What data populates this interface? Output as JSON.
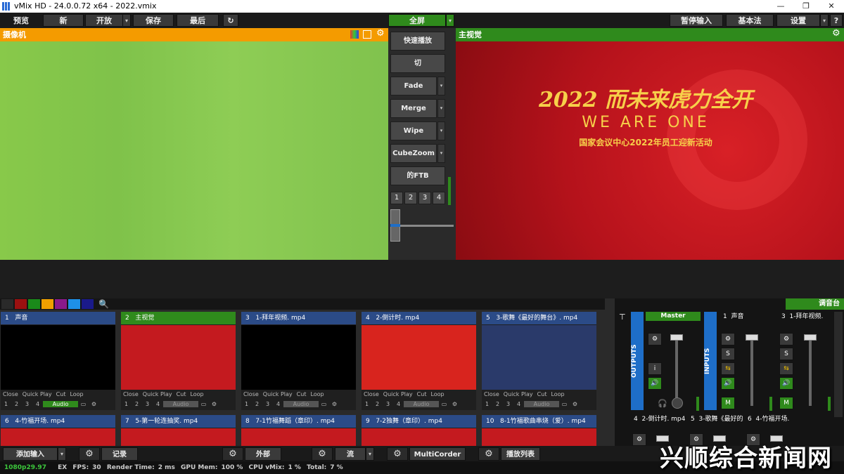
{
  "window": {
    "title": "vMix HD - 24.0.0.72 x64 - 2022.vmix",
    "minimize": "—",
    "maximize": "❐",
    "close": "✕"
  },
  "toolbar": {
    "preview_label": "预览",
    "new_label": "新",
    "open_label": "开放",
    "save_label": "保存",
    "last_label": "最后",
    "fullscreen_label": "全屏",
    "pause_input_label": "暂停输入",
    "basic_label": "基本法",
    "settings_label": "设置",
    "help_label": "?"
  },
  "preview": {
    "title": "摄像机"
  },
  "program": {
    "title": "主视觉",
    "headline": "2022 而未来虎力全开",
    "subhead": "WE ARE ONE",
    "caption": "国家会议中心2022年员工迎新活动"
  },
  "transitions": {
    "quick_play": "快速播放",
    "cut": "切",
    "fade": "Fade",
    "merge": "Merge",
    "wipe": "Wipe",
    "cubezoom": "CubeZoom",
    "ftb": "的FTB",
    "numbers": [
      "1",
      "2",
      "3",
      "4"
    ],
    "tbar_value": 0
  },
  "swatch_colors": [
    "#2a2a2a",
    "#9b1010",
    "#1a8a1a",
    "#f0a000",
    "#8a1a8a",
    "#1e90e8",
    "#1a1a8a"
  ],
  "inputs": [
    {
      "num": "1",
      "name": "声音",
      "thumb": "#000000",
      "active": false,
      "audio_on": true
    },
    {
      "num": "2",
      "name": "主视觉",
      "thumb": "#c41a1f",
      "active": true,
      "audio_on": false
    },
    {
      "num": "3",
      "name": "1-拜年视频. mp4",
      "thumb": "#000000",
      "active": false,
      "audio_on": false
    },
    {
      "num": "4",
      "name": "2-倒计时. mp4",
      "thumb": "#d8241e",
      "active": false,
      "audio_on": false
    },
    {
      "num": "5",
      "name": "3-歌舞《最好的舞台》. mp4",
      "thumb": "#2a3a6a",
      "active": false,
      "audio_on": false
    }
  ],
  "input_controls": {
    "close": "Close",
    "quick_play": "Quick Play",
    "cut": "Cut",
    "loop": "Loop",
    "audio": "Audio",
    "nums": [
      "1",
      "2",
      "3",
      "4"
    ]
  },
  "inputs_row2": [
    {
      "num": "6",
      "name": "4-竹福开场. mp4"
    },
    {
      "num": "7",
      "name": "5-第一轮连抽奖. mp4"
    },
    {
      "num": "8",
      "name": "7-1竹福舞蹈（章印）. mp4"
    },
    {
      "num": "9",
      "name": "7-2独舞（章印）. mp4"
    },
    {
      "num": "10",
      "name": "8-1竹福歌曲串烧（爱）. mp4"
    }
  ],
  "mixer": {
    "title": "调音台",
    "outputs_label": "OUTPUTS",
    "inputs_label": "INPUTS",
    "master_label": "Master",
    "channels": [
      {
        "num": "1",
        "name": "声音"
      },
      {
        "num": "3",
        "name": "1-拜年视频."
      }
    ],
    "bottom_channels": [
      {
        "num": "4",
        "name": "2-倒计时. mp4"
      },
      {
        "num": "5",
        "name": "3-歌舞《最好的"
      },
      {
        "num": "6",
        "name": "4-竹福开场."
      }
    ],
    "s_label": "S",
    "m_label": "M",
    "i_label": "i"
  },
  "bottombar": {
    "add_input": "添加输入",
    "record": "记录",
    "external": "外部",
    "stream": "流",
    "multicorder": "MultiCorder",
    "playlist": "播放列表"
  },
  "status": {
    "resolution": "1080p29.97",
    "ex": "EX",
    "fps_label": "FPS:",
    "fps": "30",
    "render_label": "Render Time:",
    "render": "2 ms",
    "gpu_label": "GPU Mem:",
    "gpu": "100 %",
    "cpu_label": "CPU vMix:",
    "cpu": "1 %",
    "total_label": "Total:",
    "total": "7 %"
  },
  "watermark": "兴顺综合新闻网"
}
